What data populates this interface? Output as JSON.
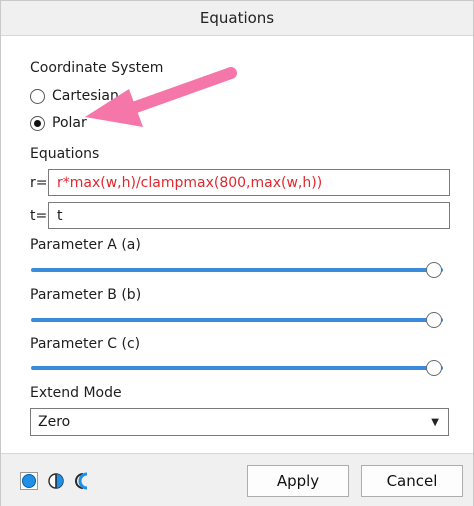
{
  "window": {
    "title": "Equations"
  },
  "coordinate_system": {
    "label": "Coordinate System",
    "options": [
      {
        "label": "Cartesian",
        "selected": false
      },
      {
        "label": "Polar",
        "selected": true
      }
    ]
  },
  "equations": {
    "label": "Equations",
    "r_prefix": "r=",
    "r_value": "r*max(w,h)/clampmax(800,max(w,h))",
    "t_prefix": "t=",
    "t_value": "t"
  },
  "parameters": [
    {
      "label": "Parameter A (a)",
      "value_fraction": 1.0
    },
    {
      "label": "Parameter B (b)",
      "value_fraction": 1.0
    },
    {
      "label": "Parameter C (c)",
      "value_fraction": 1.0
    }
  ],
  "extend_mode": {
    "label": "Extend Mode",
    "selected": "Zero"
  },
  "buttons": {
    "apply": "Apply",
    "cancel": "Cancel"
  },
  "colors": {
    "accent": "#3a8bd8",
    "arrow": "#f576a8",
    "equation_text": "#e0272e"
  },
  "icons": [
    "full-circle-mode-icon",
    "half-circle-mode-icon",
    "quarter-circle-mode-icon"
  ]
}
